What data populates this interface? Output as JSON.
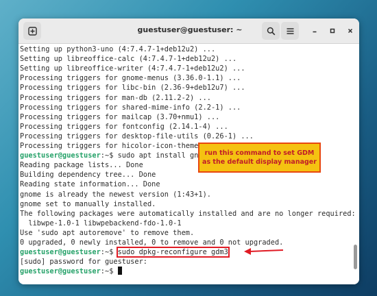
{
  "window": {
    "title": "guestuser@guestuser: ~",
    "icons": {
      "new_tab": "new-tab-icon",
      "search": "search-icon",
      "menu": "hamburger-menu-icon",
      "minimize": "minimize-icon",
      "maximize": "maximize-icon",
      "close": "close-icon"
    }
  },
  "terminal": {
    "prompt": "guestuser@guestuser",
    "lines": [
      {
        "text": "Setting up python3-uno (4:7.4.7-1+deb12u2) ..."
      },
      {
        "text": "Setting up libreoffice-calc (4:7.4.7-1+deb12u2) ..."
      },
      {
        "text": "Setting up libreoffice-writer (4:7.4.7-1+deb12u2) ..."
      },
      {
        "text": "Processing triggers for gnome-menus (3.36.0-1.1) ..."
      },
      {
        "text": "Processing triggers for libc-bin (2.36-9+deb12u7) ..."
      },
      {
        "text": "Processing triggers for man-db (2.11.2-2) ..."
      },
      {
        "text": "Processing triggers for shared-mime-info (2.2-1) ..."
      },
      {
        "text": "Processing triggers for mailcap (3.70+nmu1) ..."
      },
      {
        "text": "Processing triggers for fontconfig (2.14.1-4) ..."
      },
      {
        "text": "Processing triggers for desktop-file-utils (0.26-1) ..."
      },
      {
        "text": "Processing triggers for hicolor-icon-theme (0.17-2) ..."
      },
      {
        "prompt": "guestuser@guestuser",
        "sep": ":~$ ",
        "text": "sudo apt install gnome"
      },
      {
        "text": "Reading package lists... Done"
      },
      {
        "text": "Building dependency tree... Done"
      },
      {
        "text": "Reading state information... Done"
      },
      {
        "text": "gnome is already the newest version (1:43+1)."
      },
      {
        "text": "gnome set to manually installed."
      },
      {
        "text": "The following packages were automatically installed and are no longer required:"
      },
      {
        "text": "  libwpe-1.0-1 libwpebackend-fdo-1.0-1"
      },
      {
        "text": "Use 'sudo apt autoremove' to remove them."
      },
      {
        "text": "0 upgraded, 0 newly installed, 0 to remove and 0 not upgraded."
      },
      {
        "prompt": "guestuser@guestuser",
        "sep": ":~$ ",
        "text": "sudo dpkg-reconfigure gdm3"
      },
      {
        "text": "[sudo] password for guestuser:"
      },
      {
        "prompt": "guestuser@guestuser",
        "sep": ":~$ ",
        "text": ""
      }
    ]
  },
  "annotation": {
    "line1": "run this command to set GDM",
    "line2": "as the default display manager",
    "box_color": "#f5c211",
    "border_color": "#e8470e",
    "text_color": "#c01c28",
    "highlight_color": "#e01b24"
  },
  "colors": {
    "prompt_green": "#26a269",
    "terminal_bg": "#ffffff",
    "titlebar_bg": "#ebebeb"
  }
}
